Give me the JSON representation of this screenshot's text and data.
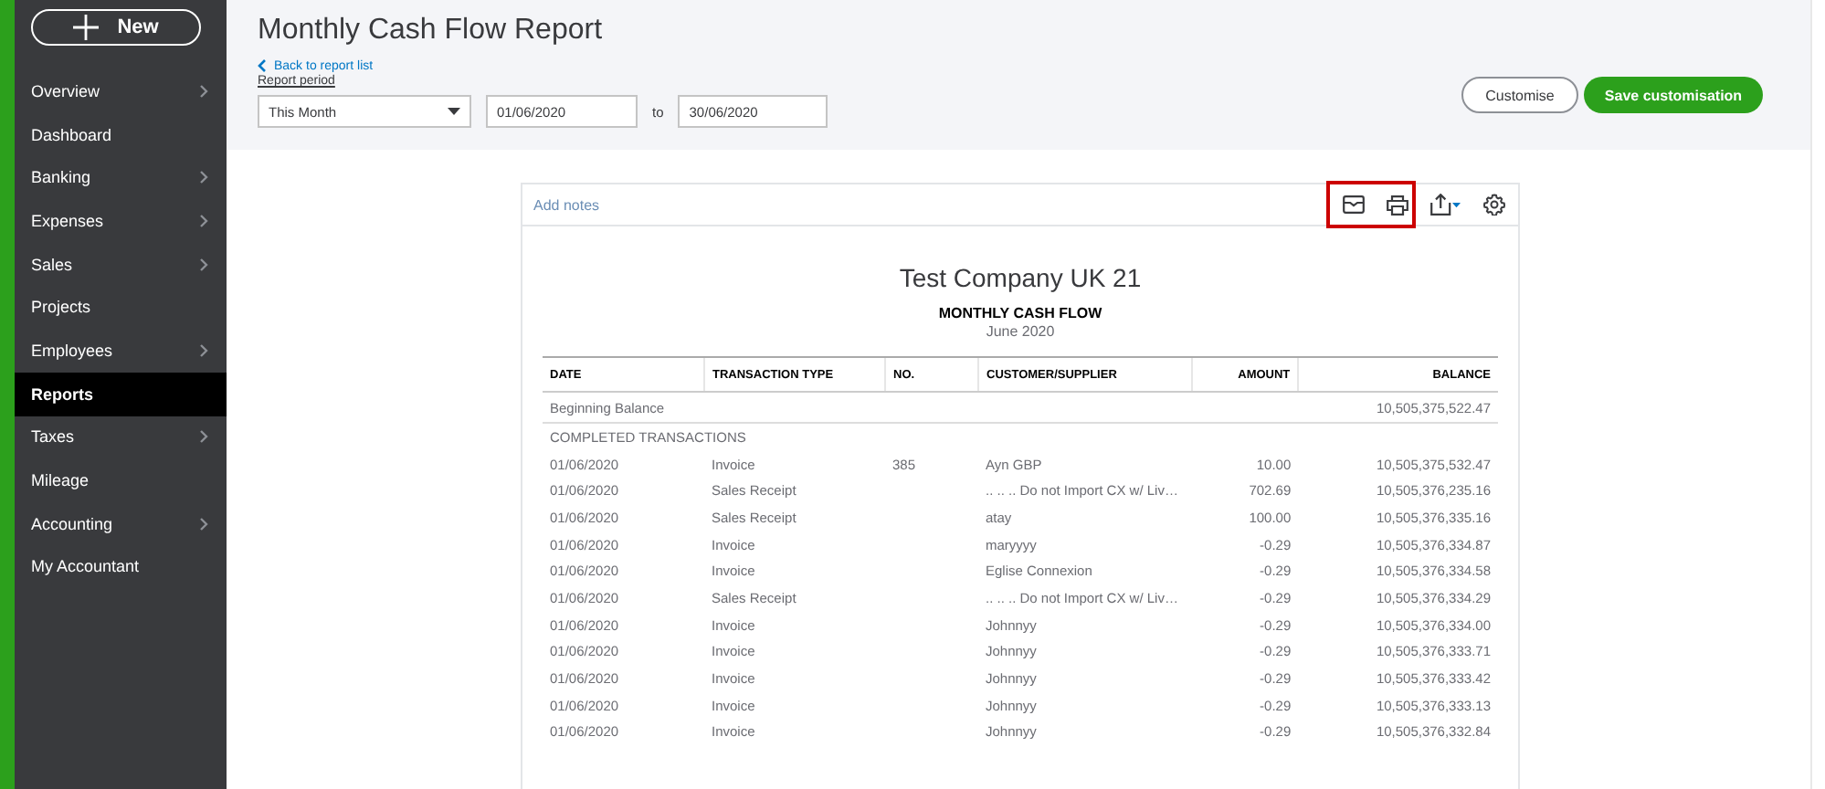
{
  "sidebar": {
    "new_button": "New",
    "items": [
      {
        "label": "Overview",
        "expandable": true,
        "selected": false
      },
      {
        "label": "Dashboard",
        "expandable": false,
        "selected": false
      },
      {
        "label": "Banking",
        "expandable": true,
        "selected": false
      },
      {
        "label": "Expenses",
        "expandable": true,
        "selected": false
      },
      {
        "label": "Sales",
        "expandable": true,
        "selected": false
      },
      {
        "label": "Projects",
        "expandable": false,
        "selected": false
      },
      {
        "label": "Employees",
        "expandable": true,
        "selected": false
      },
      {
        "label": "Reports",
        "expandable": false,
        "selected": true
      },
      {
        "label": "Taxes",
        "expandable": true,
        "selected": false
      },
      {
        "label": "Mileage",
        "expandable": false,
        "selected": false
      },
      {
        "label": "Accounting",
        "expandable": true,
        "selected": false
      },
      {
        "label": "My Accountant",
        "expandable": false,
        "selected": false
      }
    ]
  },
  "header": {
    "title": "Monthly Cash Flow Report",
    "back_link": "Back to report list",
    "period_label": "Report period",
    "period_select": "This Month",
    "from_date": "01/06/2020",
    "to_label": "to",
    "to_date": "30/06/2020",
    "buttons": [
      "Customise",
      "Save customisation"
    ]
  },
  "report": {
    "notes_link": "Add notes",
    "company": "Test Company UK 21",
    "name": "MONTHLY CASH FLOW",
    "period": "June 2020",
    "columns": [
      "DATE",
      "TRANSACTION TYPE",
      "NO.",
      "CUSTOMER/SUPPLIER",
      "AMOUNT",
      "BALANCE"
    ],
    "beginning": {
      "label": "Beginning Balance",
      "balance": "10,505,375,522.47"
    },
    "section": "COMPLETED TRANSACTIONS",
    "rows": [
      [
        "01/06/2020",
        "Invoice",
        "385",
        "Ayn GBP",
        "10.00",
        "10,505,375,532.47"
      ],
      [
        "01/06/2020",
        "Sales Receipt",
        "",
        ".. .. .. Do not Import CX w/ Liv…",
        "702.69",
        "10,505,376,235.16"
      ],
      [
        "01/06/2020",
        "Sales Receipt",
        "",
        "atay",
        "100.00",
        "10,505,376,335.16"
      ],
      [
        "01/06/2020",
        "Invoice",
        "",
        "maryyyy",
        "-0.29",
        "10,505,376,334.87"
      ],
      [
        "01/06/2020",
        "Invoice",
        "",
        "Eglise Connexion",
        "-0.29",
        "10,505,376,334.58"
      ],
      [
        "01/06/2020",
        "Sales Receipt",
        "",
        ".. .. .. Do not Import CX w/ Liv…",
        "-0.29",
        "10,505,376,334.29"
      ],
      [
        "01/06/2020",
        "Invoice",
        "",
        "Johnnyy",
        "-0.29",
        "10,505,376,334.00"
      ],
      [
        "01/06/2020",
        "Invoice",
        "",
        "Johnnyy",
        "-0.29",
        "10,505,376,333.71"
      ],
      [
        "01/06/2020",
        "Invoice",
        "",
        "Johnnyy",
        "-0.29",
        "10,505,376,333.42"
      ],
      [
        "01/06/2020",
        "Invoice",
        "",
        "Johnnyy",
        "-0.29",
        "10,505,376,333.13"
      ],
      [
        "01/06/2020",
        "Invoice",
        "",
        "Johnnyy",
        "-0.29",
        "10,505,376,332.84"
      ]
    ]
  }
}
